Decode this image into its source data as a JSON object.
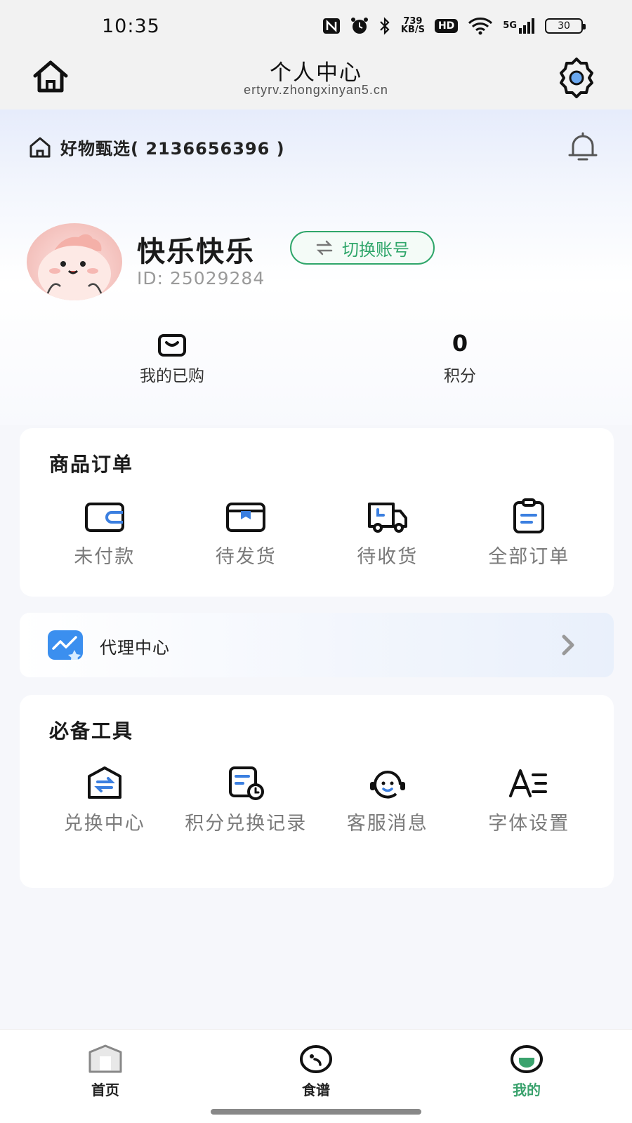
{
  "status": {
    "time": "10:35",
    "net_speed_top": "739",
    "net_speed_unit": "KB/S",
    "hd": "HD",
    "network": "5G",
    "battery": "30"
  },
  "nav": {
    "title": "个人中心",
    "url": "ertyrv.zhongxinyan5.cn"
  },
  "shop": {
    "name": "好物甄选( 2136656396 )"
  },
  "user": {
    "name": "快乐快乐",
    "switch_label": "切换账号",
    "id": "ID: 25029284"
  },
  "stats": {
    "purchased_label": "我的已购",
    "points_value": "0",
    "points_label": "积分"
  },
  "orders": {
    "title": "商品订单",
    "items": [
      {
        "label": "未付款",
        "icon": "wallet-icon"
      },
      {
        "label": "待发货",
        "icon": "package-icon"
      },
      {
        "label": "待收货",
        "icon": "truck-icon"
      },
      {
        "label": "全部订单",
        "icon": "clipboard-icon"
      }
    ]
  },
  "agent": {
    "label": "代理中心"
  },
  "tools": {
    "title": "必备工具",
    "items": [
      {
        "label": "兑换中心",
        "icon": "exchange-icon"
      },
      {
        "label": "积分兑换记录",
        "icon": "record-clock-icon"
      },
      {
        "label": "客服消息",
        "icon": "headset-icon"
      },
      {
        "label": "字体设置",
        "icon": "font-icon"
      }
    ]
  },
  "tabs": [
    {
      "label": "首页",
      "icon": "home-tab-icon",
      "active": false
    },
    {
      "label": "食谱",
      "icon": "recipe-tab-icon",
      "active": false
    },
    {
      "label": "我的",
      "icon": "profile-tab-icon",
      "active": true
    }
  ],
  "colors": {
    "accent": "#2fa66a",
    "tab_active": "#3aa26d",
    "agent_icon": "#3b8fef"
  }
}
